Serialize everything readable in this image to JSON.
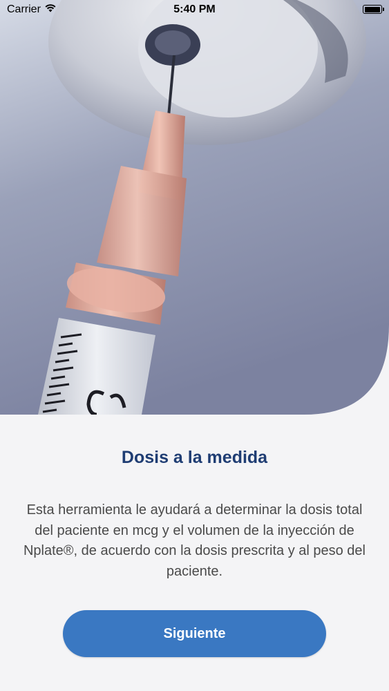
{
  "status_bar": {
    "carrier": "Carrier",
    "time": "5:40 PM",
    "battery_level": 1.0
  },
  "hero": {
    "image": "syringe-in-vial-photo"
  },
  "intro": {
    "title": "Dosis a la medida",
    "description": "Esta herramienta le ayudará a determinar la dosis total del paciente en mcg y el volumen de la inyección de Nplate®, de acuerdo con la dosis prescrita y al peso del paciente."
  },
  "actions": {
    "next_label": "Siguiente"
  },
  "colors": {
    "title": "#1f3d73",
    "button": "#3a78c2",
    "body_text": "#4a4a4a",
    "background": "#f4f4f6"
  }
}
